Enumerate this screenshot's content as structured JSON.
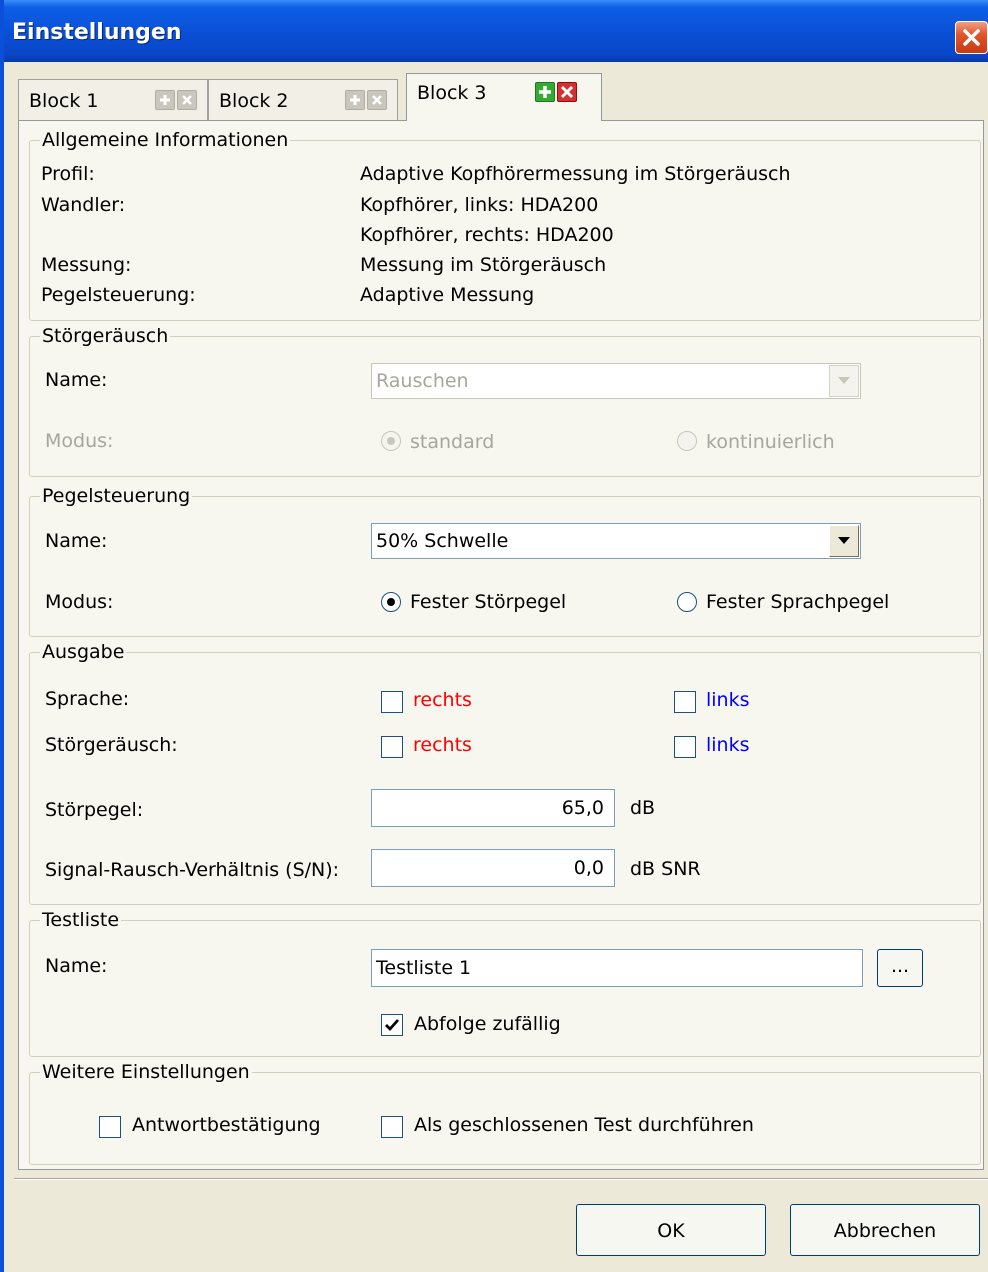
{
  "window": {
    "title": "Einstellungen"
  },
  "tabs": [
    {
      "label": "Block 1",
      "active": false
    },
    {
      "label": "Block 2",
      "active": false
    },
    {
      "label": "Block 3",
      "active": true
    }
  ],
  "info": {
    "legend": "Allgemeine Informationen",
    "rows": [
      {
        "label": "Profil:",
        "value": "Adaptive Kopfhörermessung im Störgeräusch"
      },
      {
        "label": "Wandler:",
        "value": "Kopfhörer, links: HDA200"
      },
      {
        "label": "",
        "value": "Kopfhörer, rechts: HDA200"
      },
      {
        "label": "Messung:",
        "value": "Messung im Störgeräusch"
      },
      {
        "label": "Pegelsteuerung:",
        "value": "Adaptive Messung"
      }
    ]
  },
  "noise": {
    "legend": "Störgeräusch",
    "name_label": "Name:",
    "name_value": "Rauschen",
    "mode_label": "Modus:",
    "mode_options": [
      "standard",
      "kontinuierlich"
    ]
  },
  "level": {
    "legend": "Pegelsteuerung",
    "name_label": "Name:",
    "name_value": "50% Schwelle",
    "mode_label": "Modus:",
    "mode_options": [
      "Fester Störpegel",
      "Fester Sprachpegel"
    ]
  },
  "output": {
    "legend": "Ausgabe",
    "speech_label": "Sprache:",
    "noise_label": "Störgeräusch:",
    "right_label": "rechts",
    "left_label": "links",
    "noise_level_label": "Störpegel:",
    "noise_level_value": "65,0",
    "noise_level_unit": "dB",
    "snr_label": "Signal-Rausch-Verhältnis (S/N):",
    "snr_value": "0,0",
    "snr_unit": "dB SNR",
    "right_color": "#ff0000",
    "left_color": "#0000ff"
  },
  "testlist": {
    "legend": "Testliste",
    "name_label": "Name:",
    "name_value": "Testliste 1",
    "browse_label": "...",
    "random_label": "Abfolge zufällig",
    "random_checked": true
  },
  "more": {
    "legend": "Weitere Einstellungen",
    "confirm_label": "Antwortbestätigung",
    "closed_label": "Als geschlossenen Test durchführen"
  },
  "buttons": {
    "ok": "OK",
    "cancel": "Abbrechen"
  }
}
